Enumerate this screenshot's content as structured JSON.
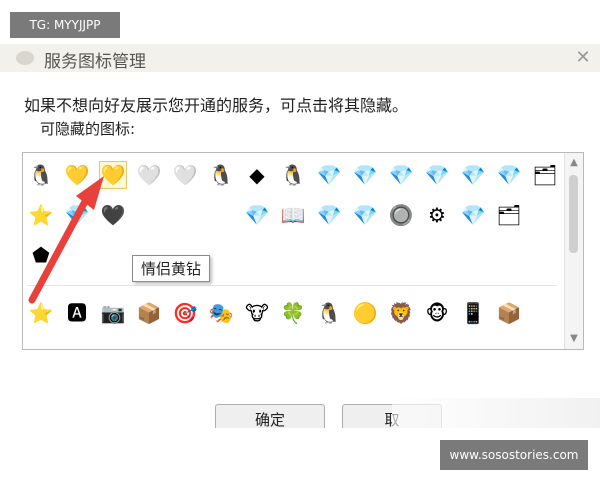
{
  "overlay": {
    "top_left_tag": "TG: MYYJJPP",
    "bottom_right_tag": "www.sosostories.com"
  },
  "window": {
    "title": "服务图标管理",
    "description": "如果不想向好友展示您开通的服务，可点击将其隐藏。",
    "hideable_label": "可隐藏的图标:",
    "tooltip": "情侣黄钻",
    "ok_label": "确定",
    "cancel_label": "取"
  },
  "icons": {
    "rows": [
      [
        "🐧",
        "💛",
        "💛",
        "🤍",
        "🤍",
        "🐧",
        "◆",
        "🐧",
        "💎",
        "💎",
        "💎",
        "💎",
        "💎",
        "💎",
        "🗂"
      ],
      [
        "⭐",
        "💎",
        "🖤",
        "",
        "",
        "",
        "💎",
        "📖",
        "💎",
        "💎",
        "🔘",
        "⚙",
        "💎",
        "🗂"
      ],
      [
        "⬟"
      ],
      [
        "⭐",
        "🅰",
        "📷",
        "📦",
        "🎯",
        "🎭",
        "🐮",
        "🍀",
        "🐧",
        "🟡",
        "🦁",
        "🐵",
        "📱",
        "📦"
      ]
    ]
  },
  "colors": {
    "accent_red": "#e8403a",
    "title_bg": "#f3f1ec",
    "panel_border": "#b9b9b9"
  }
}
